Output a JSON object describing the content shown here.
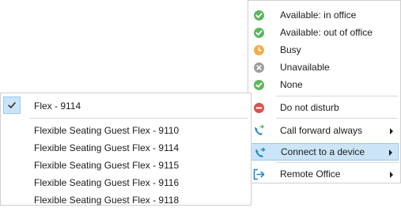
{
  "status_menu": {
    "items": [
      {
        "label": "Available: in office",
        "icon": "check-circle-icon",
        "color": "#5cb85c"
      },
      {
        "label": "Available: out of office",
        "icon": "check-circle-icon",
        "color": "#5cb85c"
      },
      {
        "label": "Busy",
        "icon": "clock-icon",
        "color": "#f0ad4e"
      },
      {
        "label": "Unavailable",
        "icon": "x-circle-icon",
        "color": "#9e9e9e"
      },
      {
        "label": "None",
        "icon": "check-circle-icon",
        "color": "#5cb85c"
      },
      {
        "label": "Do not disturb",
        "icon": "minus-circle-icon",
        "color": "#d9534f"
      },
      {
        "label": "Call forward always",
        "icon": "phone-forward-icon",
        "color": "#1e88c7"
      },
      {
        "label": "Connect to a device",
        "icon": "phone-connect-icon",
        "color": "#1e88c7"
      },
      {
        "label": "Remote Office",
        "icon": "exit-arrow-icon",
        "color": "#1e88c7"
      }
    ]
  },
  "device_submenu": {
    "selected": "Flex - 9114",
    "items": [
      "Flexible Seating Guest Flex - 9110",
      "Flexible Seating Guest Flex - 9114",
      "Flexible Seating Guest Flex - 9115",
      "Flexible Seating Guest Flex - 9116",
      "Flexible Seating Guest Flex - 9118"
    ]
  },
  "colors": {
    "highlight_bg": "#cce4f7",
    "highlight_border": "#99c9ef",
    "green": "#5cb85c",
    "orange": "#f0ad4e",
    "gray": "#9e9e9e",
    "red": "#d9534f",
    "blue": "#1e88c7"
  }
}
